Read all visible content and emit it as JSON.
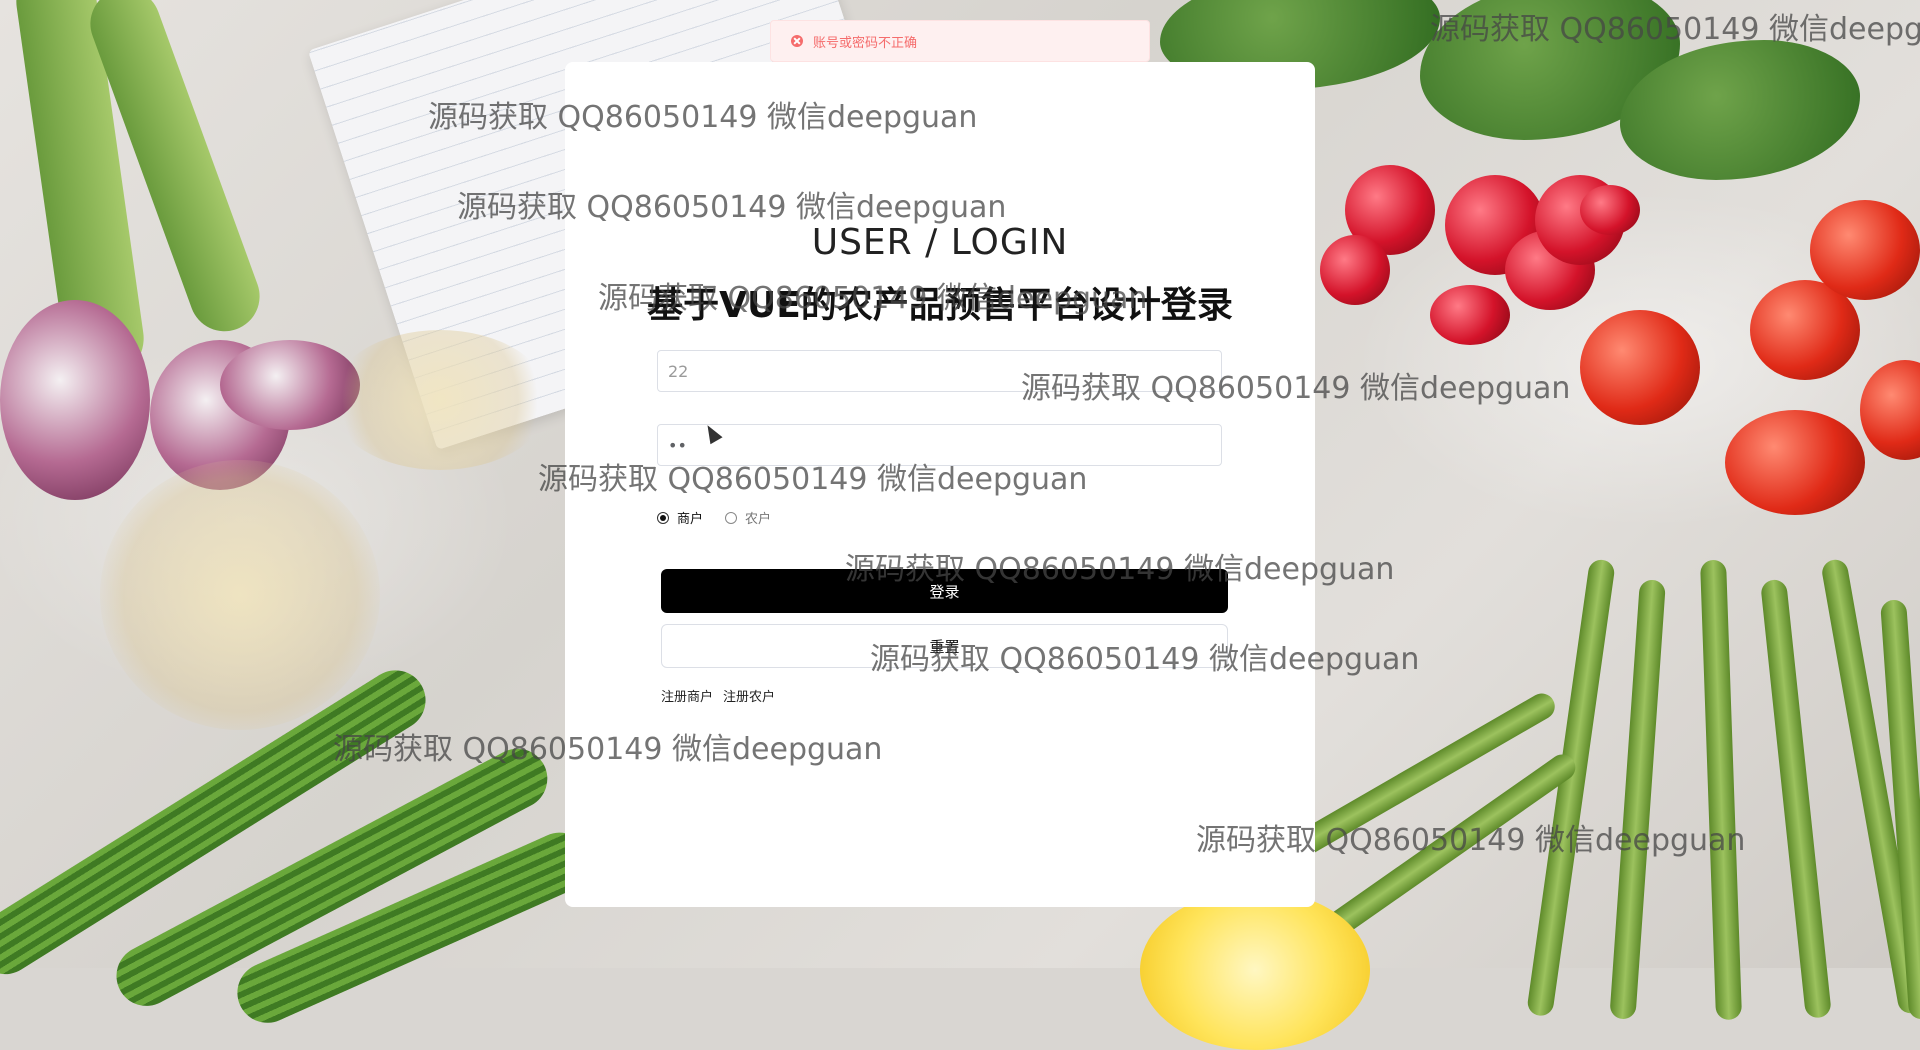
{
  "toast": {
    "icon": "error-circle-icon",
    "message": "账号或密码不正确",
    "color": "#f56c6c"
  },
  "login": {
    "heading": "USER / LOGIN",
    "title": "基于VUE的农产品预售平台设计登录",
    "username_value": "22",
    "password_value": "••",
    "roles": [
      {
        "label": "商户",
        "checked": true
      },
      {
        "label": "农户",
        "checked": false
      }
    ],
    "login_button": "登录",
    "reset_button": "重置",
    "links": [
      "注册商户",
      "注册农户"
    ]
  },
  "watermark_text": "源码获取 QQ86050149 微信deepguan",
  "colors": {
    "login_button_bg": "#000000",
    "card_bg": "#ffffff"
  }
}
